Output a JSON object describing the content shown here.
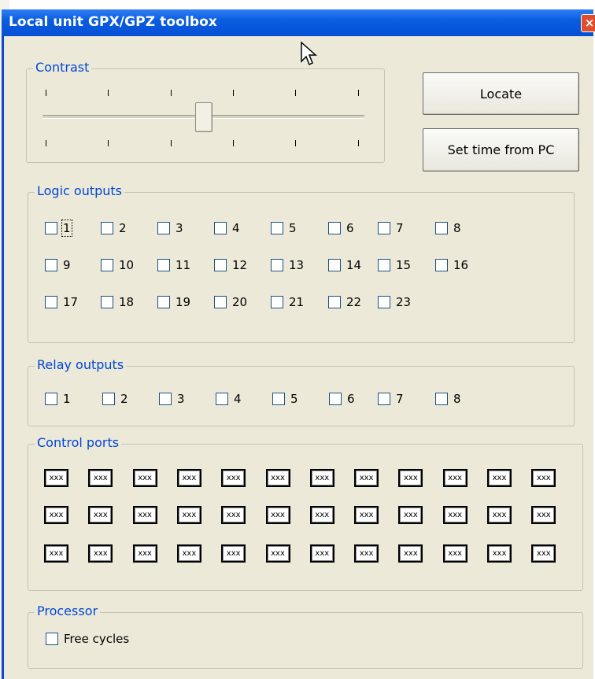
{
  "window": {
    "title": "Local unit GPX/GPZ toolbox",
    "close_label": "×"
  },
  "contrast": {
    "title": "Contrast",
    "level": 0.5
  },
  "buttons": {
    "locate": "Locate",
    "set_time": "Set time from PC"
  },
  "logic_outputs": {
    "title": "Logic outputs",
    "rows": [
      [
        "1",
        "2",
        "3",
        "4",
        "5",
        "6",
        "7",
        "8"
      ],
      [
        "9",
        "10",
        "11",
        "12",
        "13",
        "14",
        "15",
        "16"
      ],
      [
        "17",
        "18",
        "19",
        "20",
        "21",
        "22",
        "23"
      ]
    ]
  },
  "relay_outputs": {
    "title": "Relay outputs",
    "items": [
      "1",
      "2",
      "3",
      "4",
      "5",
      "6",
      "7",
      "8"
    ]
  },
  "control_ports": {
    "title": "Control ports",
    "rows": [
      [
        "xxx",
        "xxx",
        "xxx",
        "xxx",
        "xxx",
        "xxx",
        "xxx",
        "xxx",
        "xxx",
        "xxx",
        "xxx",
        "xxx"
      ],
      [
        "xxx",
        "xxx",
        "xxx",
        "xxx",
        "xxx",
        "xxx",
        "xxx",
        "xxx",
        "xxx",
        "xxx",
        "xxx",
        "xxx"
      ],
      [
        "xxx",
        "xxx",
        "xxx",
        "xxx",
        "xxx",
        "xxx",
        "xxx",
        "xxx",
        "xxx",
        "xxx",
        "xxx",
        "xxx"
      ]
    ]
  },
  "processor": {
    "title": "Processor",
    "free_cycles": "Free cycles"
  },
  "colors": {
    "title_bar": "#0a5ddf",
    "group_title": "#0046d5",
    "dialog_bg": "#ece9d8"
  }
}
